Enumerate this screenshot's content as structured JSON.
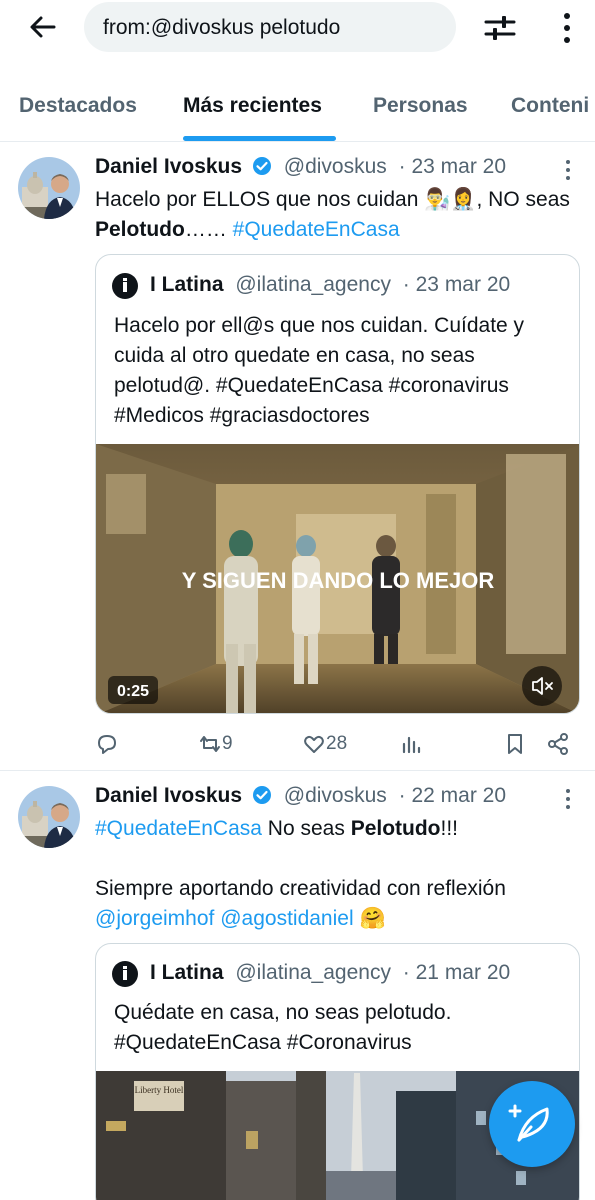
{
  "search": {
    "query": "from:@divoskus pelotudo"
  },
  "tabs": [
    "Destacados",
    "Más recientes",
    "Personas",
    "Conteni"
  ],
  "tweets": [
    {
      "name": "Daniel Ivoskus",
      "handle": "@divoskus",
      "date": "· 23 mar 20",
      "text_a": "Hacelo por ELLOS que nos cuidan ",
      "emojis": "👨‍🔬👩‍⚕️",
      "text_b": ", NO seas ",
      "bold": "Pelotudo",
      "text_c": "…… ",
      "hashtag": "#QuedateEnCasa",
      "quote": {
        "name": "I Latina",
        "handle": "@ilatina_agency",
        "date": "· 23 mar 20",
        "text": "Hacelo por ell@s que nos cuidan. Cuídate y cuida al otro quedate en casa, no seas pelotud@. ",
        "hashtags": "#QuedateEnCasa #coronavirus #Medicos #graciasdoctores",
        "video_caption": "Y SIGUEN DANDO LO MEJOR",
        "video_duration": "0:25"
      },
      "retweets": "9",
      "likes": "28"
    },
    {
      "name": "Daniel Ivoskus",
      "handle": "@divoskus",
      "date": "· 22 mar 20",
      "hashtag": "#QuedateEnCasa",
      "text_a": " No seas ",
      "bold": "Pelotudo",
      "text_b": "!!!",
      "line2": "Siempre aportando creatividad con reflexión",
      "mention1": "@jorgeimhof",
      "mention2": "@agostidaniel",
      "emoji": "🤗",
      "quote": {
        "name": "I Latina",
        "handle": "@ilatina_agency",
        "date": "· 21 mar 20",
        "text": "Quédate en casa, no seas pelotudo.",
        "hashtags": "#QuedateEnCasa #Coronavirus",
        "sign": "Liberty Hotel"
      }
    }
  ],
  "colors": {
    "accent": "#1d9bf0",
    "text": "#0f1419",
    "muted": "#536471",
    "border": "#cfd9de"
  }
}
